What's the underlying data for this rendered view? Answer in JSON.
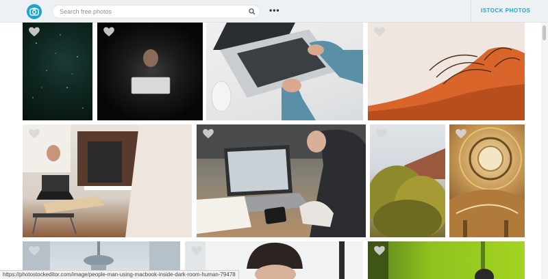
{
  "header": {
    "search_placeholder": "Search free photos",
    "more_label": "•••",
    "istock_label": "ISTOCK PHOTOS"
  },
  "icons": {
    "logo": "camera-icon",
    "search": "search-icon",
    "favorite": "heart-icon"
  },
  "colors": {
    "accent": "#1fa3c9",
    "topbar": "#eef1f3"
  },
  "status_url": "https://photostockeditor.com/image/people-man-using-macbook-inside-dark-room-human-79478"
}
